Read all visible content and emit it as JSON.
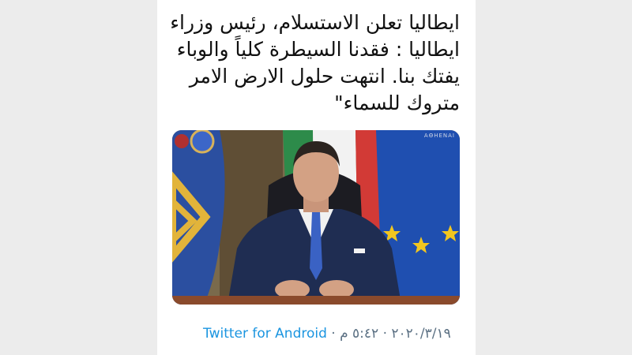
{
  "tweet": {
    "lines": [
      "ايطاليا تعلن الاستسلام، رئيس وزراء",
      "ايطاليا : فقدنا السيطرة كلياً والوباء",
      "يفتك بنا. انتهت حلول الارض الامر",
      "متروك للسماء\""
    ],
    "media": {
      "watermark": "AΘHENAI",
      "description_icon": "video-still-image"
    },
    "footer": {
      "time": "٥:٤٢ م",
      "separator": "·",
      "date": "٢٠٢٠/٣/١٩",
      "client": "Twitter for Android"
    }
  },
  "colors": {
    "text": "#111111",
    "meta": "#5b7083",
    "link": "#1b95e0",
    "card": "#ffffff",
    "background": "#ececec"
  }
}
